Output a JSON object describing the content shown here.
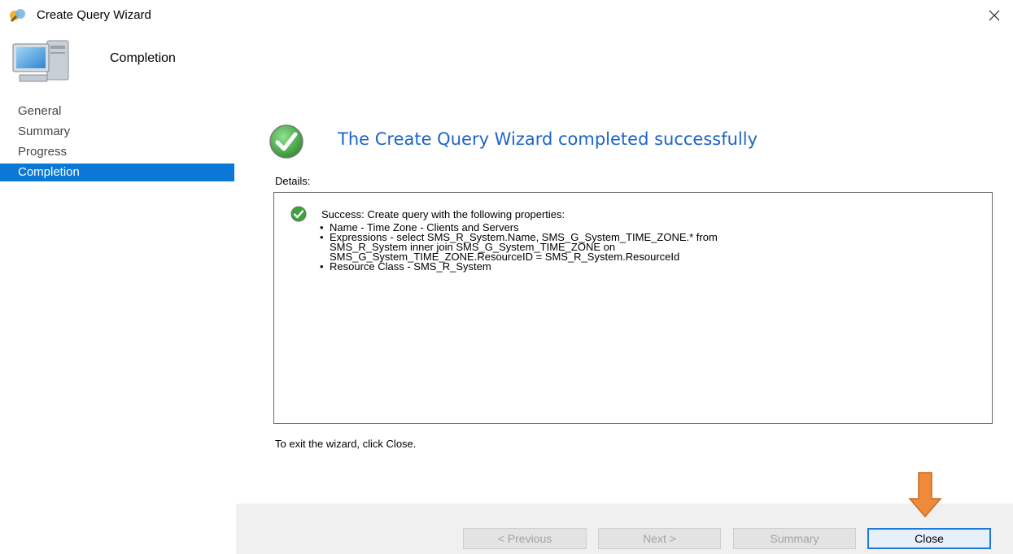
{
  "window": {
    "title": "Create Query Wizard",
    "close_glyph": "✕"
  },
  "header": {
    "title": "Completion"
  },
  "nav": {
    "items": [
      {
        "label": "General",
        "selected": false
      },
      {
        "label": "Summary",
        "selected": false
      },
      {
        "label": "Progress",
        "selected": false
      },
      {
        "label": "Completion",
        "selected": true
      }
    ]
  },
  "main": {
    "heading": "The Create Query Wizard completed successfully",
    "details_label": "Details:",
    "details": {
      "status": "Success: Create query with the following properties:",
      "items": [
        "Name - Time Zone - Clients and Servers",
        "Expressions - select SMS_R_System.Name, SMS_G_System_TIME_ZONE.* from",
        "SMS_R_System inner join SMS_G_System_TIME_ZONE on",
        "SMS_G_System_TIME_ZONE.ResourceID = SMS_R_System.ResourceId",
        "Resource Class - SMS_R_System"
      ]
    },
    "exit_text": "To exit the wizard, click Close."
  },
  "footer": {
    "previous_label": "< Previous",
    "next_label": "Next >",
    "summary_label": "Summary",
    "close_label": "Close"
  },
  "icons": {
    "app": "wizard-icon",
    "header": "computer-icon",
    "success": "checkmark-circle-icon",
    "annotation": "arrow-down-icon"
  },
  "colors": {
    "accent": "#0a78d7",
    "heading": "#1e64c8",
    "success": "#3ca23c",
    "annotation_arrow": "#ee8a3a"
  }
}
